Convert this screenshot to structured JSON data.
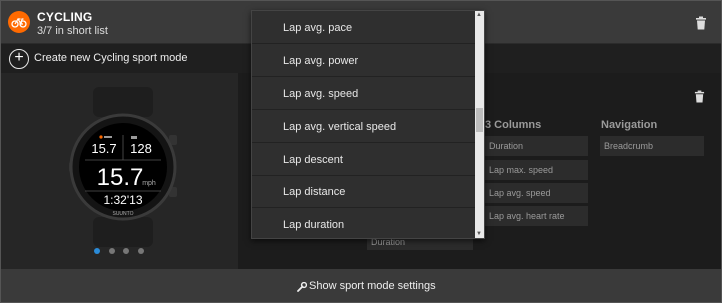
{
  "header": {
    "title": "CYCLING",
    "subtitle": "3/7 in short list"
  },
  "create": {
    "label": "Create new Cycling sport mode"
  },
  "watch": {
    "value_top_left": "15.7",
    "value_top_right": "128",
    "value_main": "15.7",
    "unit_main": "mph",
    "time": "1:32'13",
    "brand": "SUUNTO"
  },
  "pager": {
    "count": 4,
    "active_index": 0
  },
  "layout_table": {
    "columns": [
      {
        "title": "3 Columns",
        "cells": [
          "Duration",
          "Lap max. speed",
          "Lap avg. speed",
          "Lap avg. heart rate"
        ]
      },
      {
        "title": "Navigation",
        "cells": [
          "Breadcrumb"
        ]
      }
    ],
    "under_dropdown_cell": "Duration"
  },
  "dropdown": {
    "items": [
      "Lap avg. pace",
      "Lap avg. power",
      "Lap avg. speed",
      "Lap avg. vertical speed",
      "Lap descent",
      "Lap distance",
      "Lap duration"
    ],
    "scroll_position": 0.48
  },
  "footer": {
    "label": "Show sport mode settings"
  },
  "colors": {
    "accent": "#ff6a00",
    "pager_active": "#2a8bd8"
  },
  "icons": [
    "bike-icon",
    "trash-icon",
    "plus-icon",
    "wrench-icon"
  ]
}
